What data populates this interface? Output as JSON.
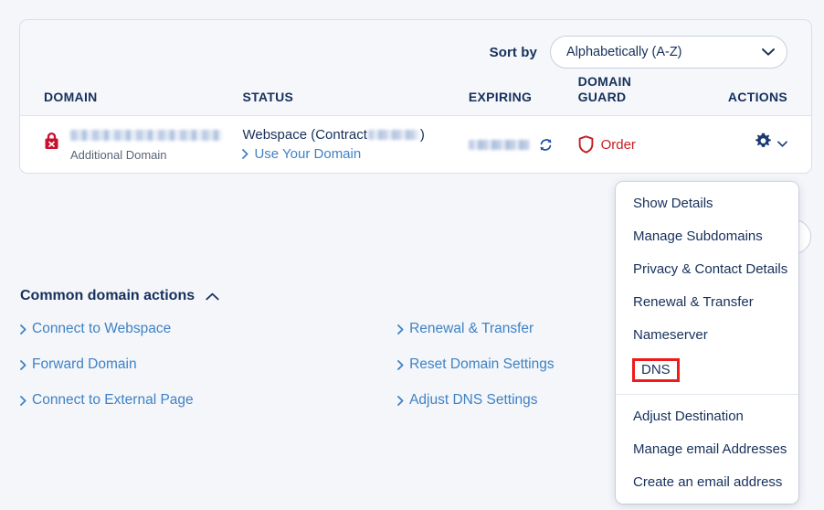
{
  "sort": {
    "label": "Sort by",
    "selected": "Alphabetically (A-Z)",
    "chevron_icon": "chevron-down-icon"
  },
  "table": {
    "headers": {
      "domain": "DOMAIN",
      "status": "STATUS",
      "expiring": "EXPIRING",
      "domain_guard": "DOMAIN GUARD",
      "actions": "ACTIONS"
    },
    "rows": [
      {
        "lock_icon": "lock-error-icon",
        "domain_name": "",
        "domain_sub_label": "Additional Domain",
        "status_prefix": "Webspace (Contract",
        "status_suffix": ")",
        "status_link": "Use Your Domain",
        "expiring": "",
        "sync_icon": "sync-icon",
        "guard_icon": "shield-icon",
        "guard_label": "Order",
        "actions_icon": "gear-icon",
        "actions_chevron": "chevron-down-icon"
      }
    ]
  },
  "actions_menu": {
    "items_top": [
      "Show Details",
      "Manage Subdomains",
      "Privacy & Contact Details",
      "Renewal & Transfer",
      "Nameserver"
    ],
    "highlighted_item": "DNS",
    "items_bottom": [
      "Adjust Destination",
      "Manage email Addresses",
      "Create an email address"
    ],
    "highlight_color": "#ef1a1a"
  },
  "common_actions": {
    "title": "Common domain actions",
    "collapse_icon": "chevron-up-icon",
    "left_column": [
      "Connect to Webspace",
      "Forward Domain",
      "Connect to External Page"
    ],
    "right_column": [
      "Renewal & Transfer",
      "Reset Domain Settings",
      "Adjust DNS Settings"
    ]
  },
  "colors": {
    "accent_link": "#3f82c4",
    "danger": "#c32026",
    "text": "#16305b",
    "page_bg": "#f4f6fa"
  }
}
